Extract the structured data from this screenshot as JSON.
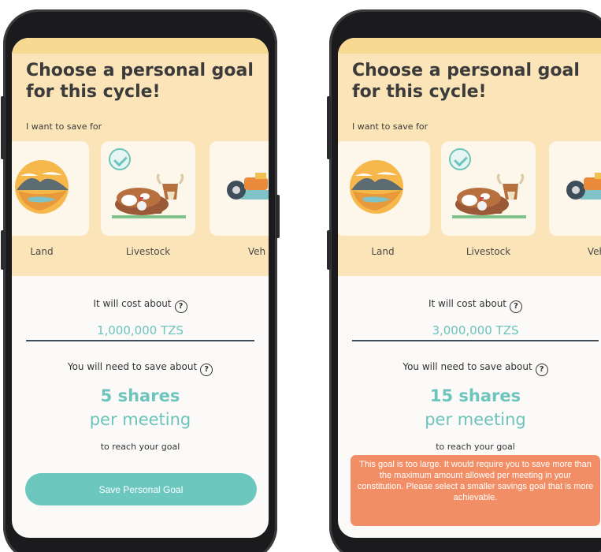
{
  "screens": [
    {
      "title": "Choose a personal goal for this cycle!",
      "subtitle": "I want to save for",
      "goals": [
        {
          "label": "Land",
          "icon": "land-icon",
          "selected": false
        },
        {
          "label": "Livestock",
          "icon": "cow-icon",
          "selected": true
        },
        {
          "label": "Veh",
          "icon": "vehicle-icon",
          "selected": false
        }
      ],
      "cost_label": "It will cost about",
      "cost_value": "1,000,000 TZS",
      "save_label": "You will need to save about",
      "shares": "5 shares",
      "per_meeting": "per meeting",
      "goal_text": "to reach your goal",
      "button_label": "Save Personal Goal"
    },
    {
      "title": "Choose a personal goal for this cycle!",
      "subtitle": "I want to save for",
      "goals": [
        {
          "label": "Land",
          "icon": "land-icon",
          "selected": false
        },
        {
          "label": "Livestock",
          "icon": "cow-icon",
          "selected": true
        },
        {
          "label": "Veh",
          "icon": "vehicle-icon",
          "selected": false
        }
      ],
      "cost_label": "It will cost about",
      "cost_value": "3,000,000 TZS",
      "save_label": "You will need to save about",
      "shares": "15 shares",
      "per_meeting": "per meeting",
      "goal_text": "to reach your goal",
      "warning": "This goal is too large. It would require you to save more than the maximum amount allowed per meeting in your constitution. Please select a smaller savings goal that is more achievable."
    }
  ],
  "help_glyph": "?",
  "colors": {
    "accent": "#6cc4bb",
    "header_bg": "#fbe4b8",
    "warning": "#f28e66",
    "phone": "#1b1b1d"
  }
}
